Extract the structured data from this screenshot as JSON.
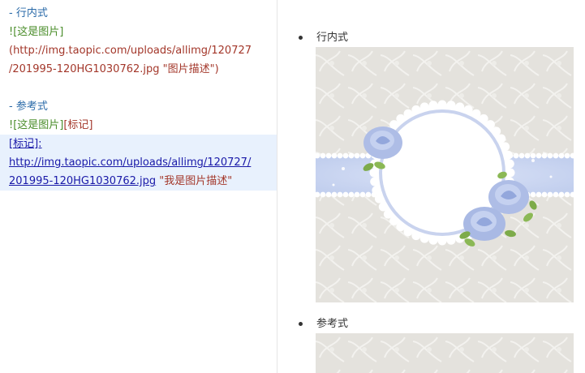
{
  "editor": {
    "inline_heading": "- 行内式",
    "inline_alt": "![这是图片]",
    "inline_url_1": "(http://img.taopic.com/uploads/allimg/120727",
    "inline_url_2": "/201995-120HG1030762.jpg",
    "inline_title": "\"图片描述\")",
    "ref_heading": "- 参考式",
    "ref_alt": "![这是图片]",
    "ref_label": "[标记]",
    "def_label": "[标记]:",
    "def_url_1": "http://img.taopic.com/uploads/allimg/120727/",
    "def_url_2": "201995-120HG1030762.jpg",
    "def_title": "\"我是图片描述\""
  },
  "preview": {
    "item1": "行内式",
    "item2": "参考式",
    "image_alt": "这是图片",
    "image_title": "图片描述"
  },
  "colors": {
    "heading": "#2a6aa8",
    "image_syntax": "#4a8d2a",
    "url": "#a3372a",
    "link": "#1919a8",
    "highlight": "#e8f1fd",
    "rose": "#aebde6",
    "ribbon": "#c9d4f0"
  }
}
